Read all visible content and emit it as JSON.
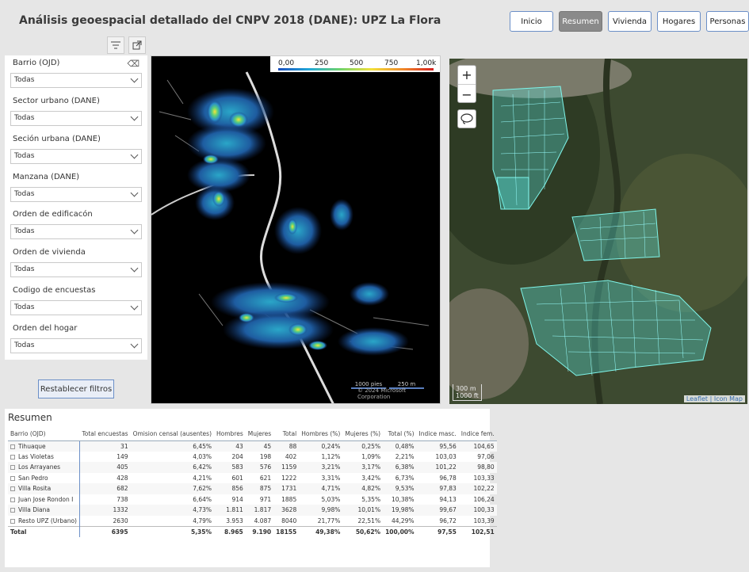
{
  "header": {
    "title": "Análisis geoespacial detallado del CNPV 2018 (DANE): UPZ La Flora"
  },
  "nav": {
    "buttons": [
      {
        "label": "Inicio",
        "active": false
      },
      {
        "label": "Resumen",
        "active": true
      },
      {
        "label": "Vivienda",
        "active": false
      },
      {
        "label": "Hogares",
        "active": false
      },
      {
        "label": "Personas",
        "active": false
      }
    ]
  },
  "filters": [
    {
      "label": "Barrio (OJD)",
      "value": "Todas"
    },
    {
      "label": "Sector urbano (DANE)",
      "value": "Todas"
    },
    {
      "label": "Seción urbana (DANE)",
      "value": "Todas"
    },
    {
      "label": "Manzana (DANE)",
      "value": "Todas"
    },
    {
      "label": "Orden de edificacón",
      "value": "Todas"
    },
    {
      "label": "Orden de vivienda",
      "value": "Todas"
    },
    {
      "label": "Codigo de encuestas",
      "value": "Todas"
    },
    {
      "label": "Orden del hogar",
      "value": "Todas"
    }
  ],
  "reset_label": "Restablecer filtros",
  "heatmap": {
    "legend_ticks": [
      "0,00",
      "250",
      "500",
      "750",
      "1,00k"
    ],
    "scale_left": "1000 pies",
    "scale_right": "250 m",
    "copyright": "© 2024 Microsoft Corporation"
  },
  "satmap": {
    "zoom_in": "+",
    "zoom_out": "−",
    "scale_m": "300 m",
    "scale_ft": "1000 ft",
    "attribution_leaflet": "Leaflet",
    "attribution_sep": " | ",
    "attribution_icon": "Icon Map"
  },
  "table": {
    "title": "Resumen",
    "columns": [
      "Barrio (OJD)",
      "Total encuestas",
      "Omision censal (ausentes)",
      "Hombres",
      "Mujeres",
      "Total",
      "Hombres (%)",
      "Mujeres (%)",
      "Total (%)",
      "Indice masc.",
      "Indice fem."
    ],
    "rows": [
      [
        "Tihuaque",
        "31",
        "6,45%",
        "43",
        "45",
        "88",
        "0,24%",
        "0,25%",
        "0,48%",
        "95,56",
        "104,65"
      ],
      [
        "Las Violetas",
        "149",
        "4,03%",
        "204",
        "198",
        "402",
        "1,12%",
        "1,09%",
        "2,21%",
        "103,03",
        "97,06"
      ],
      [
        "Los Arrayanes",
        "405",
        "6,42%",
        "583",
        "576",
        "1159",
        "3,21%",
        "3,17%",
        "6,38%",
        "101,22",
        "98,80"
      ],
      [
        "San Pedro",
        "428",
        "4,21%",
        "601",
        "621",
        "1222",
        "3,31%",
        "3,42%",
        "6,73%",
        "96,78",
        "103,33"
      ],
      [
        "Villa Rosita",
        "682",
        "7,62%",
        "856",
        "875",
        "1731",
        "4,71%",
        "4,82%",
        "9,53%",
        "97,83",
        "102,22"
      ],
      [
        "Juan Jose Rondon I",
        "738",
        "6,64%",
        "914",
        "971",
        "1885",
        "5,03%",
        "5,35%",
        "10,38%",
        "94,13",
        "106,24"
      ],
      [
        "Villa Diana",
        "1332",
        "4,73%",
        "1.811",
        "1.817",
        "3628",
        "9,98%",
        "10,01%",
        "19,98%",
        "99,67",
        "100,33"
      ],
      [
        "Resto UPZ (Urbano)",
        "2630",
        "4,79%",
        "3.953",
        "4.087",
        "8040",
        "21,77%",
        "22,51%",
        "44,29%",
        "96,72",
        "103,39"
      ]
    ],
    "total": [
      "Total",
      "6395",
      "5,35%",
      "8.965",
      "9.190",
      "18155",
      "49,38%",
      "50,62%",
      "100,00%",
      "97,55",
      "102,51"
    ]
  }
}
